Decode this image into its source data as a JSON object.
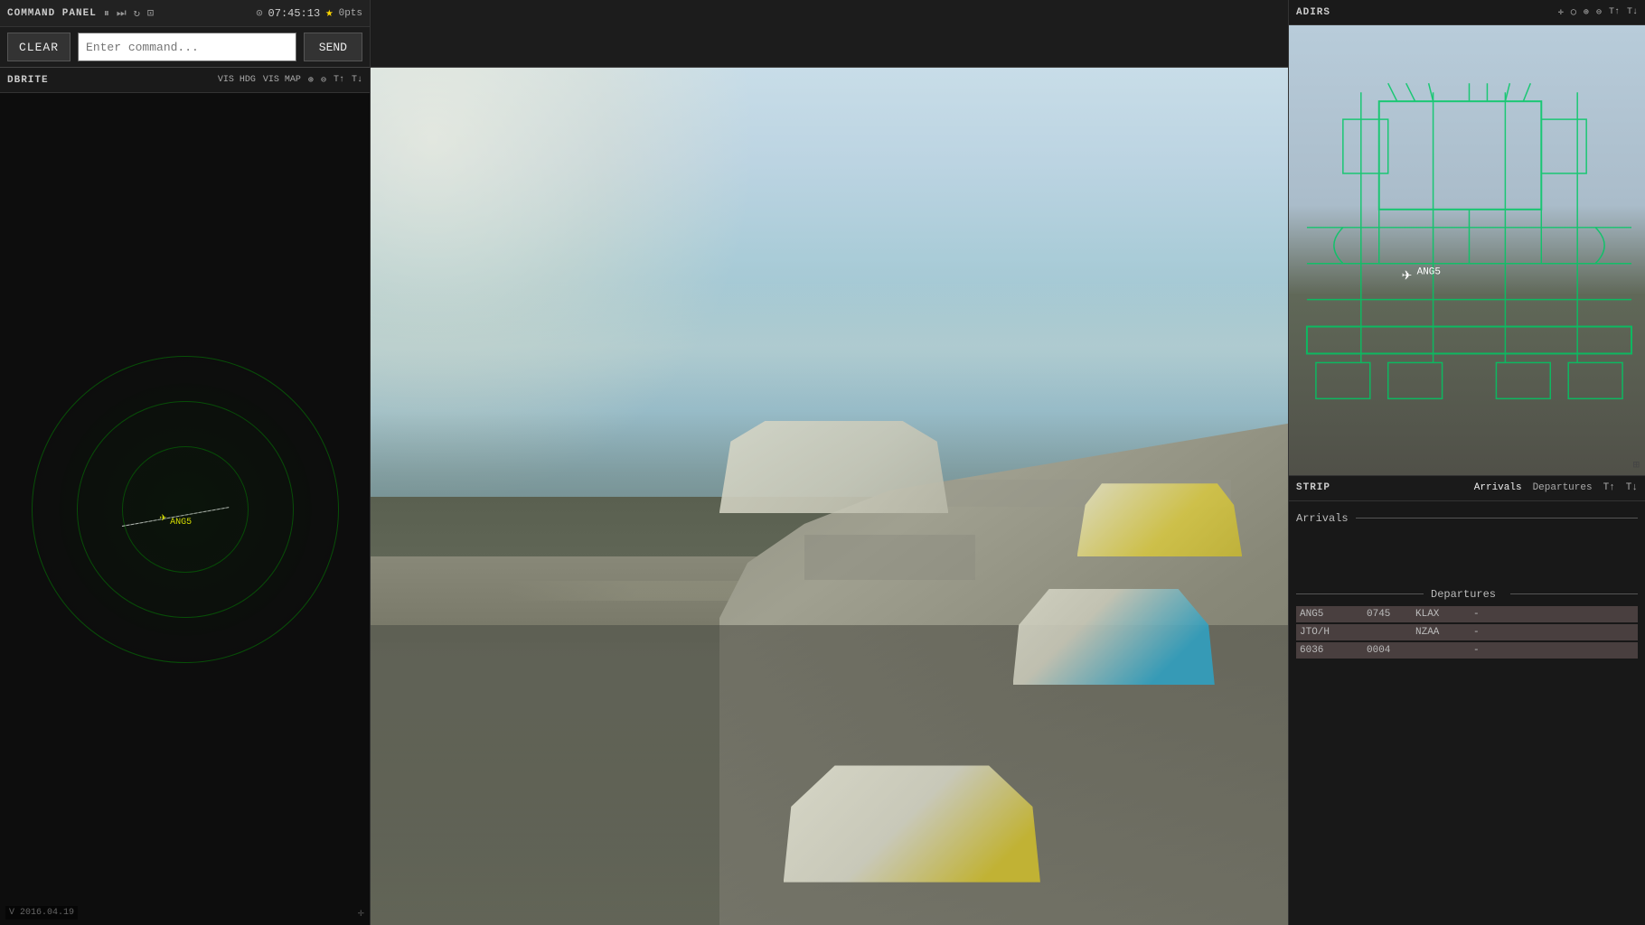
{
  "command_panel": {
    "title": "COMMAND PANEL",
    "time": "07:45:13",
    "time_icon": "⊙",
    "star_label": "★",
    "pts_label": "0pts",
    "clear_label": "CLEAR",
    "send_label": "SEND",
    "input_placeholder": "Enter command...",
    "icons": {
      "pause": "⏸",
      "forward": "⏭",
      "refresh": "↻",
      "camera": "⊡"
    }
  },
  "dbrite": {
    "title": "DBRITE",
    "controls": {
      "vis_hdg": "VIS HDG",
      "vis_map": "VIS MAP",
      "zoom_in": "⊕",
      "zoom_out": "⊖",
      "t1": "T↑",
      "t2": "T↓"
    },
    "version": "V 2016.04.19",
    "aircraft_symbol": "✈"
  },
  "adirs": {
    "title": "ADIRS",
    "controls": {
      "crosshair": "⊕",
      "circle": "◯",
      "zoom_in": "⊕",
      "zoom_out": "⊖",
      "t1": "T↑",
      "t2": "T↓"
    },
    "aircraft_label": "ANG5",
    "aircraft_symbol": "✈"
  },
  "strip": {
    "title": "STRIP",
    "tabs": {
      "arrivals": "Arrivals",
      "departures": "Departures",
      "t1": "T↑",
      "t2": "T↓"
    },
    "arrivals_section": "Arrivals",
    "departures_section": "Departures",
    "departures": [
      {
        "callsign": "ANG5",
        "time": "0745",
        "destination": "KLAX",
        "status": "-"
      },
      {
        "callsign": "JTO/H",
        "time": "",
        "destination": "NZAA",
        "status": "-"
      },
      {
        "callsign": "6036",
        "time": "0004",
        "destination": "",
        "status": "-"
      }
    ]
  },
  "viewport": {
    "scene": "airport_3d_view"
  },
  "colors": {
    "accent_green": "#00c800",
    "background_dark": "#0d0d0d",
    "text_light": "#e0e0e0",
    "text_dim": "#aaaaaa",
    "panel_bg": "#1a1a1a",
    "departure_row_bg": "rgba(220,180,180,0.25)"
  }
}
